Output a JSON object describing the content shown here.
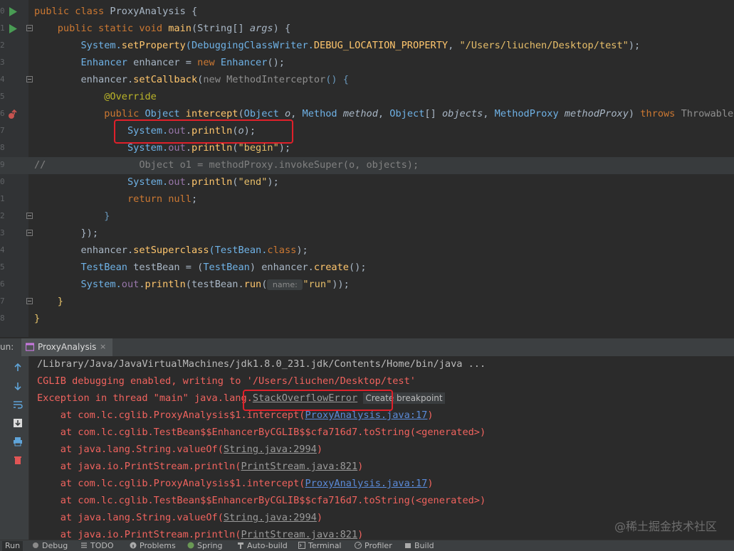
{
  "editor": {
    "lines": [
      {
        "num": "0",
        "tokens": [
          {
            "t": "public class ",
            "c": "kw"
          },
          {
            "t": "ProxyAnalysis",
            "c": "cl"
          },
          {
            "t": " {",
            "c": "cl"
          }
        ]
      },
      {
        "num": "1",
        "tokens": [
          {
            "t": "    public static void ",
            "c": "kw"
          },
          {
            "t": "main",
            "c": "fn"
          },
          {
            "t": "(String[] ",
            "c": "cl"
          },
          {
            "t": "args",
            "c": "par"
          },
          {
            "t": ") {",
            "c": "cl"
          }
        ]
      },
      {
        "num": "2",
        "tokens": [
          {
            "t": "        System.",
            "c": "ty"
          },
          {
            "t": "setProperty",
            "c": "fn"
          },
          {
            "t": "(DebuggingClassWriter.",
            "c": "ty"
          },
          {
            "t": "DEBUG_LOCATION_PROPERTY",
            "c": "sf"
          },
          {
            "t": ", ",
            "c": "cl"
          },
          {
            "t": "\"/Users/liuchen/Desktop/test\"",
            "c": "str"
          },
          {
            "t": ");",
            "c": "cl"
          }
        ]
      },
      {
        "num": "3",
        "tokens": [
          {
            "t": "        Enhancer ",
            "c": "ty"
          },
          {
            "t": "enhancer = ",
            "c": "cl"
          },
          {
            "t": "new ",
            "c": "kw"
          },
          {
            "t": "Enhancer",
            "c": "ty"
          },
          {
            "t": "();",
            "c": "cl"
          }
        ]
      },
      {
        "num": "4",
        "tokens": [
          {
            "t": "        enhancer.",
            "c": "cl"
          },
          {
            "t": "setCallback",
            "c": "fn"
          },
          {
            "t": "(",
            "c": "cl"
          },
          {
            "t": "new MethodInterceptor",
            "c": "gray"
          },
          {
            "t": "() {",
            "c": "blu"
          }
        ]
      },
      {
        "num": "5",
        "tokens": [
          {
            "t": "            @Override",
            "c": "an"
          }
        ]
      },
      {
        "num": "6",
        "tokens": [
          {
            "t": "            public ",
            "c": "kw"
          },
          {
            "t": "Object ",
            "c": "ty"
          },
          {
            "t": "intercept",
            "c": "fn"
          },
          {
            "t": "(",
            "c": "cl"
          },
          {
            "t": "Object ",
            "c": "ty"
          },
          {
            "t": "o",
            "c": "par"
          },
          {
            "t": ", ",
            "c": "cl"
          },
          {
            "t": "Method ",
            "c": "ty"
          },
          {
            "t": "method",
            "c": "par"
          },
          {
            "t": ", ",
            "c": "cl"
          },
          {
            "t": "Object",
            "c": "ty"
          },
          {
            "t": "[] ",
            "c": "cl"
          },
          {
            "t": "objects",
            "c": "par"
          },
          {
            "t": ", ",
            "c": "cl"
          },
          {
            "t": "MethodProxy ",
            "c": "ty"
          },
          {
            "t": "methodProxy",
            "c": "par"
          },
          {
            "t": ") ",
            "c": "cl"
          },
          {
            "t": "throws ",
            "c": "kw"
          },
          {
            "t": "Throwable {",
            "c": "gray"
          }
        ]
      },
      {
        "num": "7",
        "tokens": [
          {
            "t": "                System.",
            "c": "ty"
          },
          {
            "t": "out",
            "c": "mt"
          },
          {
            "t": ".",
            "c": "cl"
          },
          {
            "t": "println",
            "c": "fn"
          },
          {
            "t": "(",
            "c": "cl"
          },
          {
            "t": "o",
            "c": "par"
          },
          {
            "t": ");",
            "c": "cl"
          }
        ]
      },
      {
        "num": "8",
        "tokens": [
          {
            "t": "                System.",
            "c": "ty"
          },
          {
            "t": "out",
            "c": "mt"
          },
          {
            "t": ".",
            "c": "cl"
          },
          {
            "t": "println",
            "c": "fn"
          },
          {
            "t": "(",
            "c": "cl"
          },
          {
            "t": "\"begin\"",
            "c": "str"
          },
          {
            "t": ");",
            "c": "cl"
          }
        ]
      },
      {
        "num": "9",
        "tokens": [
          {
            "t": "//                Object o1 = methodProxy.invokeSuper(o, objects);",
            "c": "cm"
          }
        ]
      },
      {
        "num": "0",
        "tokens": [
          {
            "t": "                System.",
            "c": "ty"
          },
          {
            "t": "out",
            "c": "mt"
          },
          {
            "t": ".",
            "c": "cl"
          },
          {
            "t": "println",
            "c": "fn"
          },
          {
            "t": "(",
            "c": "cl"
          },
          {
            "t": "\"end\"",
            "c": "str"
          },
          {
            "t": ");",
            "c": "cl"
          }
        ]
      },
      {
        "num": "1",
        "tokens": [
          {
            "t": "                return null",
            "c": "kw"
          },
          {
            "t": ";",
            "c": "cl"
          }
        ]
      },
      {
        "num": "2",
        "tokens": [
          {
            "t": "            }",
            "c": "blu"
          }
        ]
      },
      {
        "num": "3",
        "tokens": [
          {
            "t": "        });",
            "c": "cl"
          }
        ]
      },
      {
        "num": "4",
        "tokens": [
          {
            "t": "        enhancer.",
            "c": "cl"
          },
          {
            "t": "setSuperclass",
            "c": "fn"
          },
          {
            "t": "(TestBean.",
            "c": "ty"
          },
          {
            "t": "class",
            "c": "kw"
          },
          {
            "t": ");",
            "c": "cl"
          }
        ]
      },
      {
        "num": "5",
        "tokens": [
          {
            "t": "        TestBean ",
            "c": "ty"
          },
          {
            "t": "testBean = (",
            "c": "cl"
          },
          {
            "t": "TestBean",
            "c": "ty"
          },
          {
            "t": ") enhancer.",
            "c": "cl"
          },
          {
            "t": "create",
            "c": "fn"
          },
          {
            "t": "();",
            "c": "cl"
          }
        ]
      },
      {
        "num": "6",
        "tokens": [
          {
            "t": "        System.",
            "c": "ty"
          },
          {
            "t": "out",
            "c": "mt"
          },
          {
            "t": ".",
            "c": "cl"
          },
          {
            "t": "println",
            "c": "fn"
          },
          {
            "t": "(testBean.",
            "c": "cl"
          },
          {
            "t": "run",
            "c": "fn"
          },
          {
            "t": "(",
            "c": "cl"
          },
          {
            "t": " name: ",
            "c": "hint"
          },
          {
            "t": "\"run\"",
            "c": "str"
          },
          {
            "t": "));",
            "c": "cl"
          }
        ]
      },
      {
        "num": "7",
        "tokens": [
          {
            "t": "    }",
            "c": "bra"
          }
        ]
      },
      {
        "num": "8",
        "tokens": [
          {
            "t": "}",
            "c": "bra"
          }
        ]
      }
    ]
  },
  "run_panel": {
    "label": "un:",
    "tab_title": "ProxyAnalysis",
    "close_glyph": "×"
  },
  "console": {
    "lines": [
      {
        "style": "gr",
        "parts": [
          {
            "t": "/Library/Java/JavaVirtualMachines/jdk1.8.0_231.jdk/Contents/Home/bin/java ..."
          }
        ]
      },
      {
        "style": "err",
        "parts": [
          {
            "t": "CGLIB debugging enabled, writing to '/Users/liuchen/Desktop/test'"
          }
        ]
      },
      {
        "style": "err",
        "parts": [
          {
            "t": "Exception in thread \"main\" java.lang."
          },
          {
            "t": "StackOverflowError",
            "c": "lnkg"
          },
          {
            "t": " "
          },
          {
            "t": "Create breakpoint",
            "c": "cbk"
          }
        ]
      },
      {
        "style": "err",
        "parts": [
          {
            "t": "    at com.lc.cglib.ProxyAnalysis$1.intercept("
          },
          {
            "t": "ProxyAnalysis.java:17",
            "c": "lnk"
          },
          {
            "t": ")"
          }
        ]
      },
      {
        "style": "err",
        "parts": [
          {
            "t": "    at com.lc.cglib.TestBean$$EnhancerByCGLIB$$cfa716d7.toString(<generated>)"
          }
        ]
      },
      {
        "style": "err",
        "parts": [
          {
            "t": "    at java.lang.String.valueOf("
          },
          {
            "t": "String.java:2994",
            "c": "lnkg"
          },
          {
            "t": ")"
          }
        ]
      },
      {
        "style": "err",
        "parts": [
          {
            "t": "    at java.io.PrintStream.println("
          },
          {
            "t": "PrintStream.java:821",
            "c": "lnkg"
          },
          {
            "t": ")"
          }
        ]
      },
      {
        "style": "err",
        "parts": [
          {
            "t": "    at com.lc.cglib.ProxyAnalysis$1.intercept("
          },
          {
            "t": "ProxyAnalysis.java:17",
            "c": "lnk"
          },
          {
            "t": ")"
          }
        ]
      },
      {
        "style": "err",
        "parts": [
          {
            "t": "    at com.lc.cglib.TestBean$$EnhancerByCGLIB$$cfa716d7.toString(<generated>)"
          }
        ]
      },
      {
        "style": "err",
        "parts": [
          {
            "t": "    at java.lang.String.valueOf("
          },
          {
            "t": "String.java:2994",
            "c": "lnkg"
          },
          {
            "t": ")"
          }
        ]
      },
      {
        "style": "err",
        "parts": [
          {
            "t": "    at java.io.PrintStream.println("
          },
          {
            "t": "PrintStream.java:821",
            "c": "lnkg"
          },
          {
            "t": ")"
          }
        ]
      }
    ]
  },
  "status_bar": {
    "items": [
      {
        "label": "Run",
        "icon": "none"
      },
      {
        "label": "Debug",
        "icon": "bug-icon"
      },
      {
        "label": "TODO",
        "icon": "list-icon"
      },
      {
        "label": "Problems",
        "icon": "info-icon"
      },
      {
        "label": "Spring",
        "icon": "leaf-icon"
      },
      {
        "label": "Auto-build",
        "icon": "hammer-icon"
      },
      {
        "label": "Terminal",
        "icon": "terminal-icon"
      },
      {
        "label": "Profiler",
        "icon": "profiler-icon"
      },
      {
        "label": "Build",
        "icon": "build-icon"
      }
    ]
  },
  "watermark": "@稀土掘金技术社区",
  "colors": {
    "error_red": "#f0635e",
    "highlight_box": "#e0202a",
    "run_green": "#499c54"
  }
}
